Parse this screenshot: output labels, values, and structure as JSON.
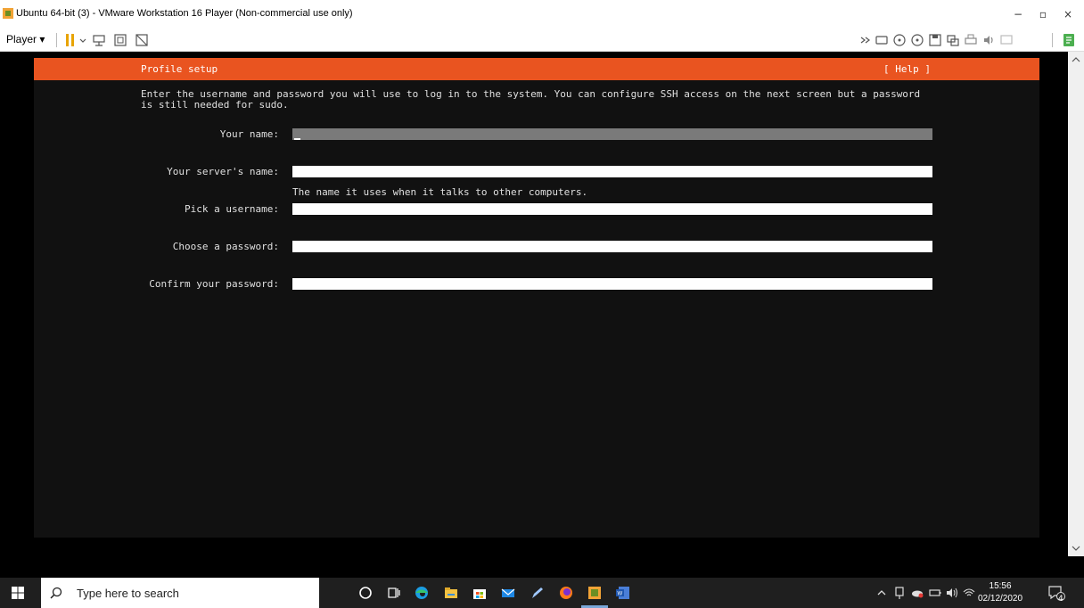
{
  "window": {
    "title": "Ubuntu 64-bit (3) - VMware Workstation 16 Player (Non-commercial use only)",
    "minimize": "−",
    "maximize": "▫",
    "close": "×"
  },
  "toolbar": {
    "player_menu": "Player ▾"
  },
  "installer": {
    "title": "Profile setup",
    "help": "[ Help ]",
    "description": "Enter the username and password you will use to log in to the system. You can configure SSH access on the next screen but a password is still needed for sudo.",
    "fields": {
      "name_label": "Your name:",
      "name_value": "",
      "server_label": "Your server's name:",
      "server_value": "",
      "server_hint": "The name it uses when it talks to other computers.",
      "username_label": "Pick a username:",
      "username_value": "",
      "password_label": "Choose a password:",
      "password_value": "",
      "confirm_label": "Confirm your password:",
      "confirm_value": ""
    }
  },
  "taskbar": {
    "search_placeholder": "Type here to search",
    "time": "15:56",
    "date": "02/12/2020",
    "notification_count": "4"
  },
  "colors": {
    "ubuntu_orange": "#e95420",
    "terminal_bg": "#111111"
  }
}
